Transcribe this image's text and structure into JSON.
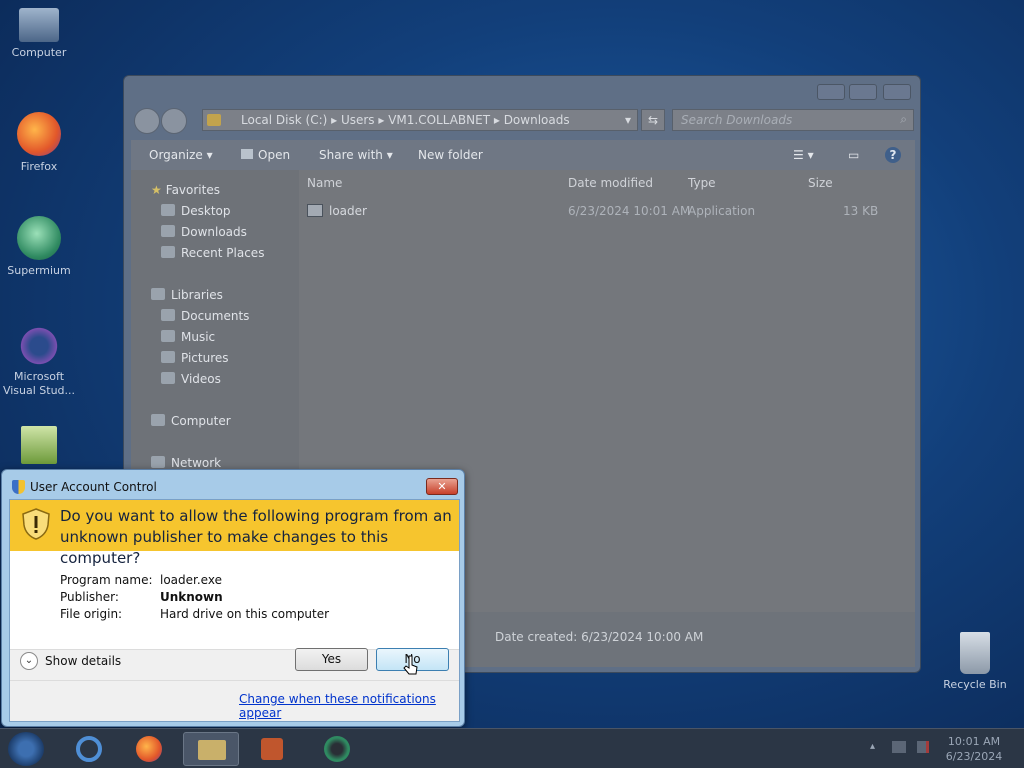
{
  "desktop": {
    "icons": [
      {
        "label": "Computer"
      },
      {
        "label": "Firefox"
      },
      {
        "label": "Supermium"
      },
      {
        "label": "Microsoft Visual Stud..."
      },
      {
        "label": "Recycle Bin"
      }
    ]
  },
  "explorer": {
    "breadcrumb": [
      "Local Disk (C:)",
      "Users",
      "VM1.COLLABNET",
      "Downloads"
    ],
    "search_placeholder": "Search Downloads",
    "toolbar": {
      "organize": "Organize",
      "open": "Open",
      "share_with": "Share with",
      "new_folder": "New folder"
    },
    "nav": {
      "favorites": "Favorites",
      "fav_items": [
        "Desktop",
        "Downloads",
        "Recent Places"
      ],
      "libraries": "Libraries",
      "lib_items": [
        "Documents",
        "Music",
        "Pictures",
        "Videos"
      ],
      "computer": "Computer",
      "network": "Network"
    },
    "columns": {
      "name": "Name",
      "date": "Date modified",
      "type": "Type",
      "size": "Size"
    },
    "file": {
      "name": "loader",
      "date": "6/23/2024 10:01 AM",
      "type": "Application",
      "size": "13 KB"
    },
    "details": {
      "date_created": "Date created: 6/23/2024 10:00 AM"
    }
  },
  "uac": {
    "title": "User Account Control",
    "question": "Do you want to allow the following program from an unknown publisher to make changes to this computer?",
    "program_name_label": "Program name:",
    "program_name": "loader.exe",
    "publisher_label": "Publisher:",
    "publisher": "Unknown",
    "file_origin_label": "File origin:",
    "file_origin": "Hard drive on this computer",
    "show_details": "Show details",
    "yes": "Yes",
    "no": "No",
    "change_link": "Change when these notifications appear",
    "banner_color": "#f6c52e"
  },
  "taskbar": {
    "time": "10:01 AM",
    "date": "6/23/2024"
  }
}
